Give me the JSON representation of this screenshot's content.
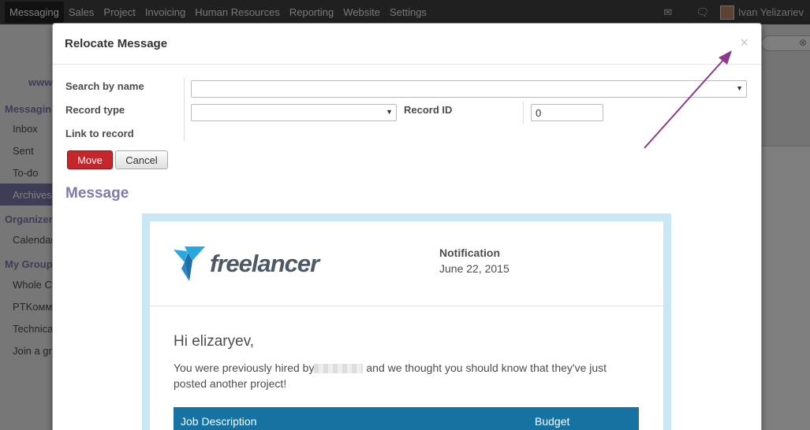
{
  "topbar": {
    "menu": [
      "Messaging",
      "Sales",
      "Project",
      "Invoicing",
      "Human Resources",
      "Reporting",
      "Website",
      "Settings"
    ],
    "active_index": 0,
    "user_name": "Ivan Yelizariev"
  },
  "sidebar": {
    "logo": "www",
    "section_messaging": "Messagin",
    "items_messaging": [
      "Inbox",
      "Sent",
      "To-do",
      "Archives"
    ],
    "section_organizer": "Organizer",
    "items_organizer": [
      "Calendar"
    ],
    "section_groups": "My Group",
    "items_groups": [
      "Whole C",
      "PTKомм",
      "Technica",
      "Join a gr"
    ]
  },
  "modal": {
    "title": "Relocate Message",
    "close_symbol": "×",
    "labels": {
      "search_by_name": "Search by name",
      "record_type": "Record type",
      "record_id": "Record ID",
      "link_to_record": "Link to record"
    },
    "record_id_value": "0",
    "move_label": "Move",
    "cancel_label": "Cancel",
    "message_heading": "Message"
  },
  "email": {
    "brand": "freelancer",
    "notification_title": "Notification",
    "notification_date": "June 22, 2015",
    "greeting": "Hi elizaryev,",
    "body_before": "You were previously hired by",
    "body_after": " and we thought you should know that they've just posted another project!",
    "table_col_1": "Job Description",
    "table_col_2": "Budget"
  },
  "colors": {
    "accent": "#7c7bad",
    "move_button": "#c4262b",
    "email_frame": "#c9e7f5",
    "table_header": "#1572a1",
    "arrow": "#8e3a8c"
  }
}
